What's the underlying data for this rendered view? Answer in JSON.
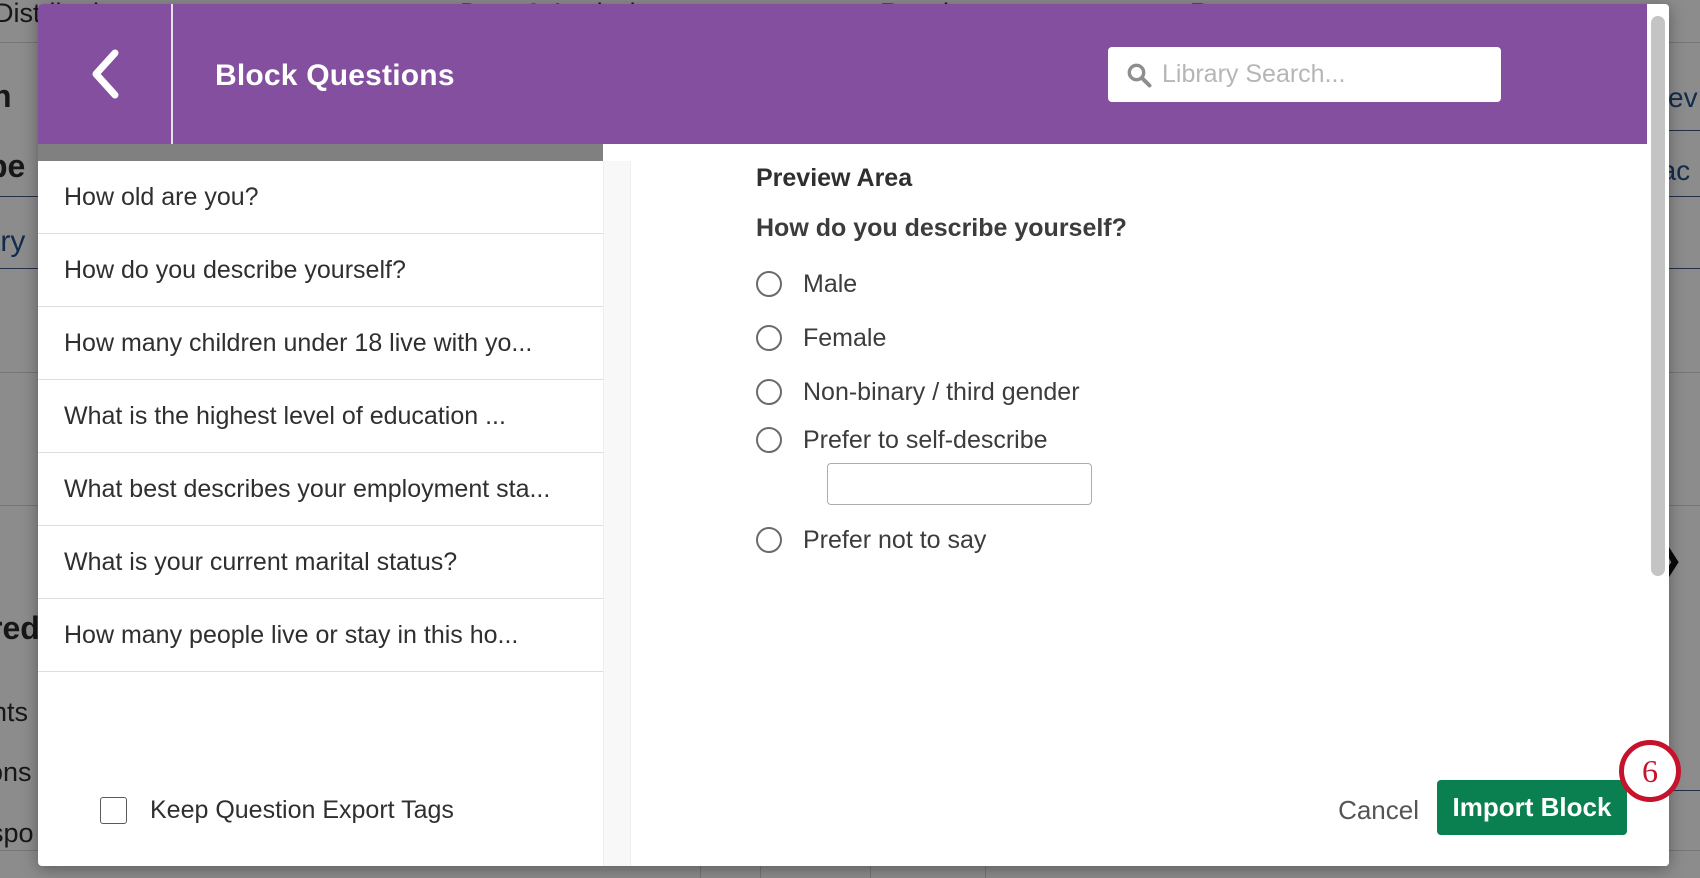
{
  "background": {
    "tabs": [
      "Distributions",
      "Data & Analysis",
      "Results",
      "Reports"
    ],
    "fragments": [
      {
        "text": "n",
        "bold": true
      },
      {
        "text": "be",
        "bold": true
      },
      {
        "text": "try",
        "link": true
      },
      {
        "text": "red",
        "bold": true
      },
      {
        "text": "nts"
      },
      {
        "text": "ons"
      },
      {
        "text": "spo"
      },
      {
        "text": "Prev",
        "link": true
      },
      {
        "text": "bac",
        "link": true
      }
    ]
  },
  "modal": {
    "title": "Block Questions",
    "back_icon": "chevron-left-icon",
    "search": {
      "icon": "search-icon",
      "placeholder": "Library Search...",
      "value": ""
    },
    "questions": [
      "How old are you?",
      "How do you describe yourself?",
      "How many children under 18 live with yo...",
      "What is the highest level of education ...",
      "What best describes your employment sta...",
      "What is your current marital status?",
      "How many people live or stay in this ho..."
    ],
    "preview": {
      "heading": "Preview Area",
      "question": "How do you describe yourself?",
      "choices": [
        {
          "label": "Male",
          "has_text_input": false
        },
        {
          "label": "Female",
          "has_text_input": false
        },
        {
          "label": "Non-binary / third gender",
          "has_text_input": false
        },
        {
          "label": "Prefer to self-describe",
          "has_text_input": true,
          "text_value": ""
        },
        {
          "label": "Prefer not to say",
          "has_text_input": false
        }
      ]
    },
    "footer": {
      "keep_tags_label": "Keep Question Export Tags",
      "keep_tags_checked": false,
      "cancel_label": "Cancel",
      "import_label": "Import Block"
    }
  },
  "annotation": {
    "step_number": "6"
  },
  "colors": {
    "header_purple": "#834f9e",
    "import_green": "#0a8050",
    "annotation_red": "#c6122c",
    "dim_overlay": "rgba(0,0,0,0.45)"
  }
}
